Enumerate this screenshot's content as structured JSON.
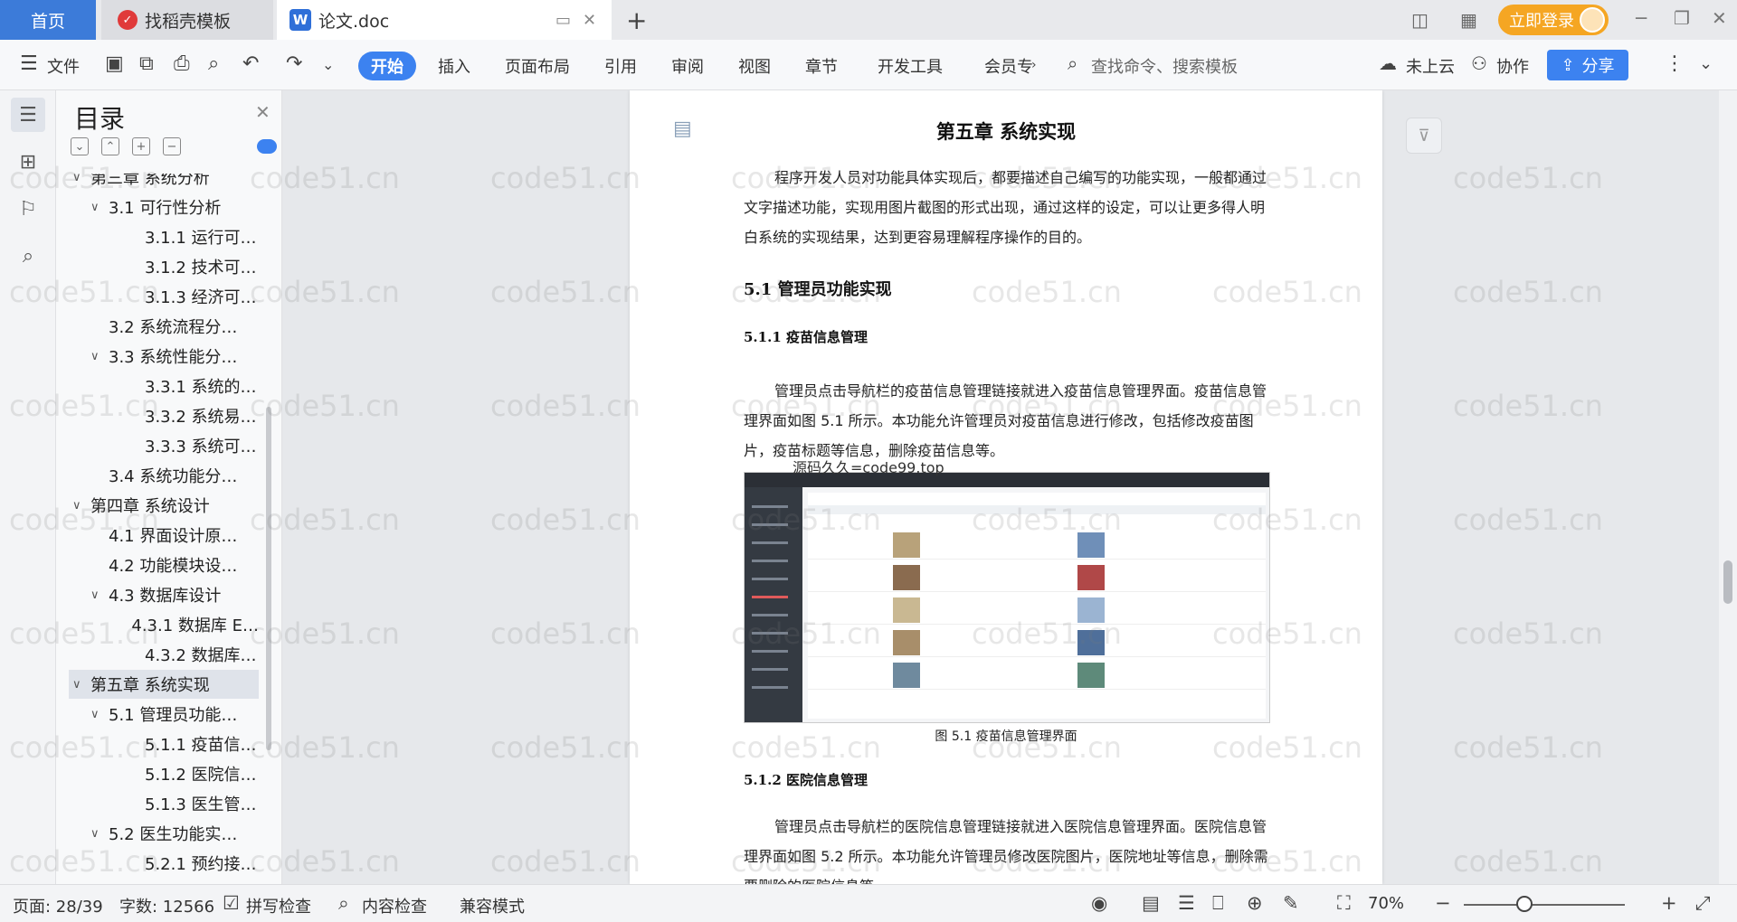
{
  "titlebar": {
    "home_tab": "首页",
    "template_tab": "找稻壳模板",
    "doc_tab": "论文.doc",
    "doc_icon": "W",
    "login": "立即登录"
  },
  "ribbon": {
    "file": "文件",
    "tabs": [
      "开始",
      "插入",
      "页面布局",
      "引用",
      "审阅",
      "视图",
      "章节",
      "开发工具",
      "会员专"
    ],
    "search_placeholder": "查找命令、搜索模板",
    "cloud": "未上云",
    "collab": "协作",
    "share": "分享"
  },
  "toc": {
    "title": "目录",
    "items": [
      {
        "label": "第三章 系统分析",
        "level": 1,
        "arrow": "⌄"
      },
      {
        "label": "3.1 可行性分析",
        "level": 2,
        "arrow": "⌄"
      },
      {
        "label": "3.1.1 运行可…",
        "level": 3,
        "arrow": ""
      },
      {
        "label": "3.1.2 技术可…",
        "level": 3,
        "arrow": ""
      },
      {
        "label": "3.1.3 经济可…",
        "level": 3,
        "arrow": ""
      },
      {
        "label": "3.2 系统流程分…",
        "level": 2,
        "arrow": ""
      },
      {
        "label": "3.3 系统性能分…",
        "level": 2,
        "arrow": "⌄"
      },
      {
        "label": "3.3.1 系统的…",
        "level": 3,
        "arrow": ""
      },
      {
        "label": "3.3.2 系统易…",
        "level": 3,
        "arrow": ""
      },
      {
        "label": "3.3.3 系统可…",
        "level": 3,
        "arrow": ""
      },
      {
        "label": "3.4 系统功能分…",
        "level": 2,
        "arrow": ""
      },
      {
        "label": "第四章 系统设计",
        "level": 1,
        "arrow": "⌄"
      },
      {
        "label": "4.1 界面设计原…",
        "level": 2,
        "arrow": ""
      },
      {
        "label": "4.2 功能模块设…",
        "level": 2,
        "arrow": ""
      },
      {
        "label": "4.3 数据库设计",
        "level": 2,
        "arrow": "⌄"
      },
      {
        "label": "4.3.1 数据库 E…",
        "level": 3,
        "arrow": ""
      },
      {
        "label": "4.3.2 数据库…",
        "level": 3,
        "arrow": ""
      },
      {
        "label": "第五章 系统实现",
        "level": 1,
        "arrow": "⌄",
        "selected": true
      },
      {
        "label": "5.1 管理员功能…",
        "level": 2,
        "arrow": "⌄"
      },
      {
        "label": "5.1.1 疫苗信…",
        "level": 3,
        "arrow": ""
      },
      {
        "label": "5.1.2 医院信…",
        "level": 3,
        "arrow": ""
      },
      {
        "label": "5.1.3 医生管…",
        "level": 3,
        "arrow": ""
      },
      {
        "label": "5.2 医生功能实…",
        "level": 2,
        "arrow": "⌄"
      },
      {
        "label": "5.2.1 预约接…",
        "level": 3,
        "arrow": ""
      }
    ]
  },
  "document": {
    "chapter_title": "第五章 系统实现",
    "intro": "程序开发人员对功能具体实现后，都要描述自己编写的功能实现，一般都通过文字描述功能，实现用图片截图的形式出现，通过这样的设定，可以让更多得人明白系统的实现结果，达到更容易理解程序操作的目的。",
    "section_5_1": "5.1  管理员功能实现",
    "section_5_1_1": "5.1.1  疫苗信息管理",
    "para_5_1_1": "管理员点击导航栏的疫苗信息管理链接就进入疫苗信息管理界面。疫苗信息管理界面如图 5.1 所示。本功能允许管理员对疫苗信息进行修改，包括修改疫苗图片，疫苗标题等信息，删除疫苗信息等。",
    "figure_source": "源码久久=code99.top",
    "figure_caption": "图 5.1  疫苗信息管理界面",
    "section_5_1_2": "5.1.2  医院信息管理",
    "para_5_1_2": "管理员点击导航栏的医院信息管理链接就进入医院信息管理界面。医院信息管理界面如图 5.2 所示。本功能允许管理员修改医院图片，医院地址等信息，删除需要删除的医院信息等。"
  },
  "watermark": "code51.cn",
  "statusbar": {
    "page": "页面: 28/39",
    "words": "字数: 12566",
    "spell": "拼写检查",
    "content_check": "内容检查",
    "compat": "兼容模式",
    "zoom": "70%"
  },
  "colors": {
    "accent": "#3c82f0",
    "login": "#f5a623",
    "home_tab": "#3c7bd9"
  }
}
